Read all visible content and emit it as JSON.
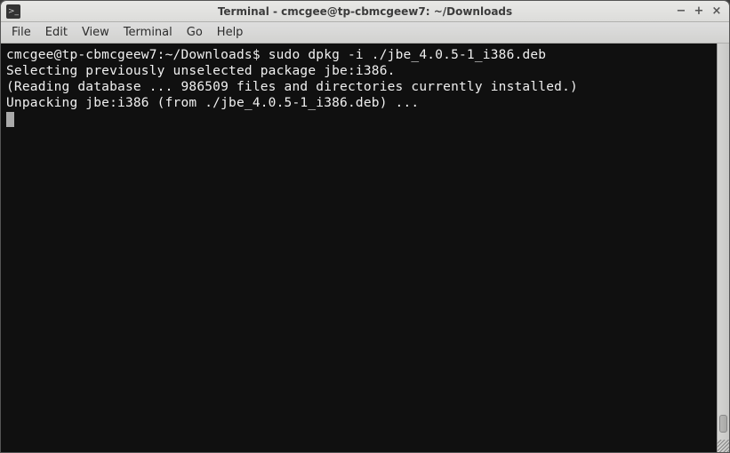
{
  "window": {
    "title": "Terminal - cmcgee@tp-cbmcgeew7: ~/Downloads"
  },
  "menu": {
    "file": "File",
    "edit": "Edit",
    "view": "View",
    "terminal": "Terminal",
    "go": "Go",
    "help": "Help"
  },
  "terminal": {
    "prompt": "cmcgee@tp-cbmcgeew7:~/Downloads$ ",
    "command": "sudo dpkg -i ./jbe_4.0.5-1_i386.deb",
    "line1": "Selecting previously unselected package jbe:i386.",
    "line2": "(Reading database ... 986509 files and directories currently installed.)",
    "line3": "Unpacking jbe:i386 (from ./jbe_4.0.5-1_i386.deb) ..."
  },
  "window_controls": {
    "minimize": "−",
    "maximize": "+",
    "close": "×"
  }
}
